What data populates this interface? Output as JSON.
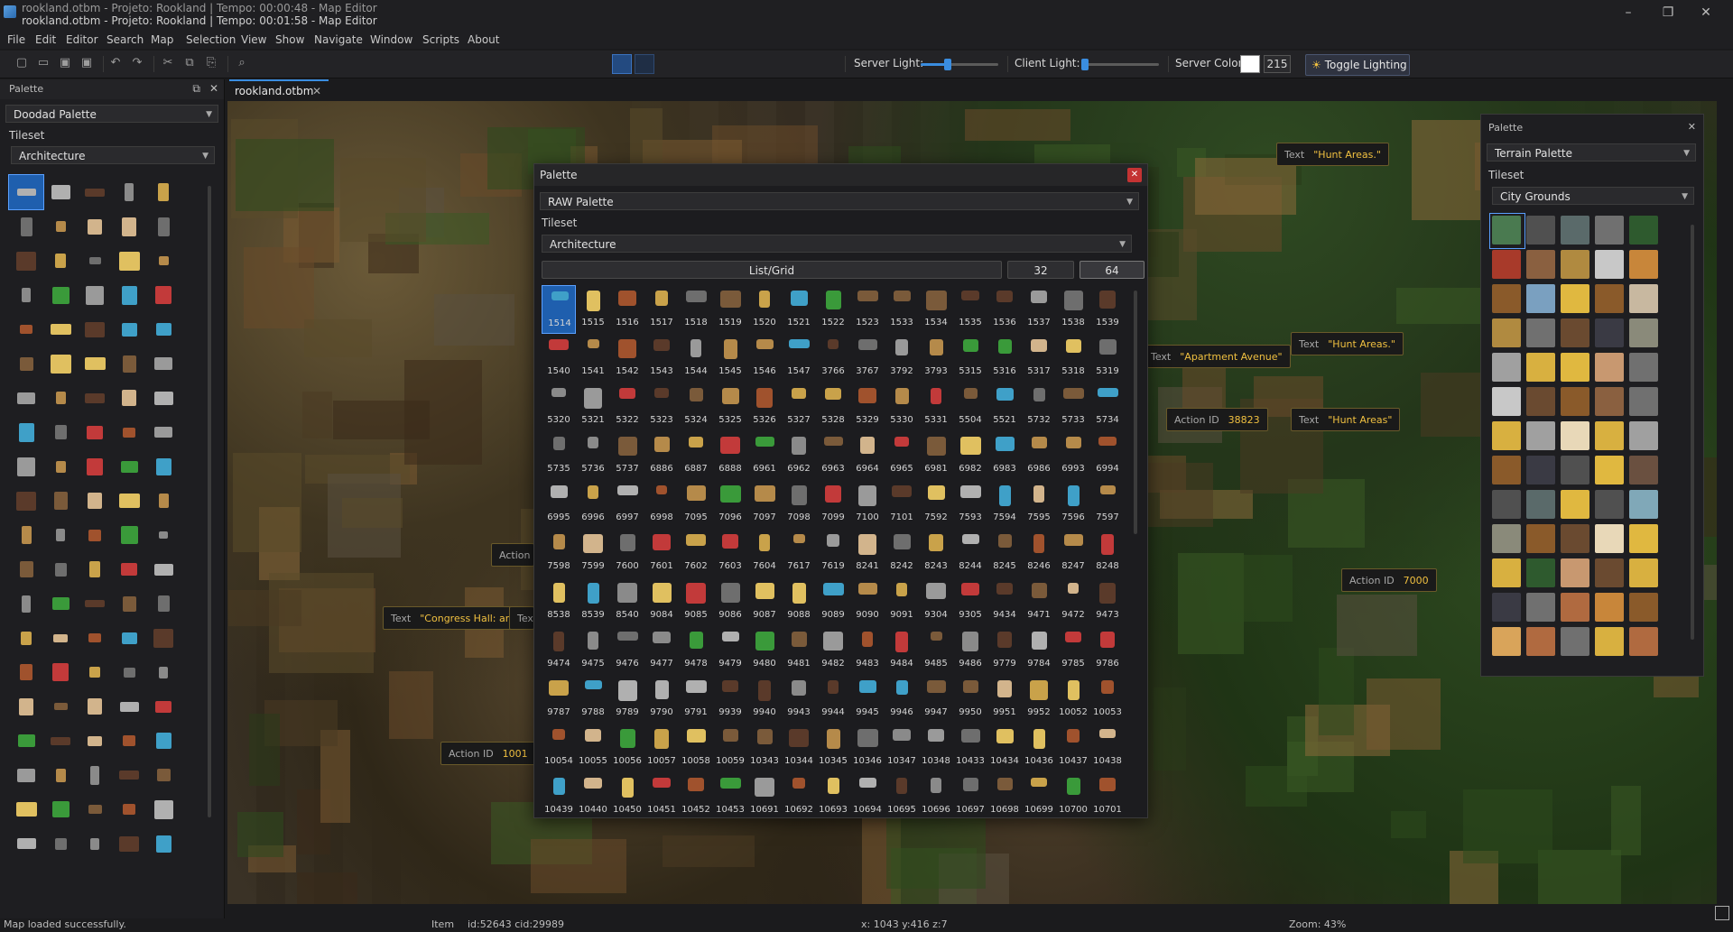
{
  "window": {
    "title_back": "rookland.otbm - Projeto: Rookland | Tempo: 00:00:48 - Map Editor",
    "title": "rookland.otbm - Projeto: Rookland | Tempo: 00:01:58 - Map Editor",
    "minimize": "–",
    "maximize": "❐",
    "close": "✕"
  },
  "menu": [
    "File",
    "Edit",
    "Editor",
    "Search",
    "Map",
    "Selection",
    "View",
    "Show",
    "Navigate",
    "Window",
    "Scripts",
    "About"
  ],
  "toolbar": {
    "server_light_label": "Server Light:",
    "server_light_level": 0.35,
    "client_light_label": "Client Light:",
    "client_light_level": 0.05,
    "server_color_label": "Server Color:",
    "server_color_value": "215",
    "toggle_lighting": "Toggle Lighting"
  },
  "left_palette": {
    "title": "Palette",
    "palette_select": "Doodad Palette",
    "tileset_label": "Tileset",
    "tileset_select": "Architecture"
  },
  "doc_tab": {
    "label": "rookland.otbm",
    "close": "✕"
  },
  "map_labels": [
    {
      "key": "Text",
      "value": "\"Hunt Areas.\""
    },
    {
      "key": "Text",
      "value": "\"Apartment Avenue\""
    },
    {
      "key": "Text",
      "value": "\"Hunt Areas.\""
    },
    {
      "key": "Action ID",
      "value": "38823"
    },
    {
      "key": "Text",
      "value": "\"Hunt Areas\""
    },
    {
      "key": "Action ID",
      "value": "7000"
    },
    {
      "key": "Text",
      "value": "\"Congress Hall: ar"
    },
    {
      "key": "Text",
      "value": ""
    },
    {
      "key": "Action",
      "value": ""
    },
    {
      "key": "Action ID",
      "value": "1001"
    }
  ],
  "raw_palette": {
    "title": "Palette",
    "close": "✕",
    "palette_select": "RAW Palette",
    "tileset_label": "Tileset",
    "tileset_select": "Architecture",
    "list_grid": "List/Grid",
    "size_small": "32",
    "size_large": "64",
    "item_ids": [
      "1514",
      "1515",
      "1516",
      "1517",
      "1518",
      "1519",
      "1520",
      "1521",
      "1522",
      "1523",
      "1533",
      "1534",
      "1535",
      "1536",
      "1537",
      "1538",
      "1539",
      "1540",
      "1541",
      "1542",
      "1543",
      "1544",
      "1545",
      "1546",
      "1547",
      "3766",
      "3767",
      "3792",
      "3793",
      "5315",
      "5316",
      "5317",
      "5318",
      "5319",
      "5320",
      "5321",
      "5322",
      "5323",
      "5324",
      "5325",
      "5326",
      "5327",
      "5328",
      "5329",
      "5330",
      "5331",
      "5504",
      "5521",
      "5732",
      "5733",
      "5734",
      "5735",
      "5736",
      "5737",
      "6886",
      "6887",
      "6888",
      "6961",
      "6962",
      "6963",
      "6964",
      "6965",
      "6981",
      "6982",
      "6983",
      "6986",
      "6993",
      "6994",
      "6995",
      "6996",
      "6997",
      "6998",
      "7095",
      "7096",
      "7097",
      "7098",
      "7099",
      "7100",
      "7101",
      "7592",
      "7593",
      "7594",
      "7595",
      "7596",
      "7597",
      "7598",
      "7599",
      "7600",
      "7601",
      "7602",
      "7603",
      "7604",
      "7617",
      "7619",
      "8241",
      "8242",
      "8243",
      "8244",
      "8245",
      "8246",
      "8247",
      "8248",
      "8538",
      "8539",
      "8540",
      "9084",
      "9085",
      "9086",
      "9087",
      "9088",
      "9089",
      "9090",
      "9091",
      "9304",
      "9305",
      "9434",
      "9471",
      "9472",
      "9473",
      "9474",
      "9475",
      "9476",
      "9477",
      "9478",
      "9479",
      "9480",
      "9481",
      "9482",
      "9483",
      "9484",
      "9485",
      "9486",
      "9779",
      "9784",
      "9785",
      "9786",
      "9787",
      "9788",
      "9789",
      "9790",
      "9791",
      "9939",
      "9940",
      "9943",
      "9944",
      "9945",
      "9946",
      "9947",
      "9950",
      "9951",
      "9952",
      "10052",
      "10053",
      "10054",
      "10055",
      "10056",
      "10057",
      "10058",
      "10059",
      "10343",
      "10344",
      "10345",
      "10346",
      "10347",
      "10348",
      "10433",
      "10434",
      "10436",
      "10437",
      "10438",
      "10439",
      "10440",
      "10450",
      "10451",
      "10452",
      "10453",
      "10691",
      "10692",
      "10693",
      "10694",
      "10695",
      "10696",
      "10697",
      "10698",
      "10699",
      "10700",
      "10701"
    ],
    "selected_id": "1514"
  },
  "right_palette": {
    "title": "Palette",
    "close": "✕",
    "palette_select": "Terrain Palette",
    "tileset_label": "Tileset",
    "tileset_select": "City Grounds"
  },
  "status": {
    "message": "Map loaded successfully.",
    "item": "Item",
    "item_ids": "id:52643 cid:29989",
    "coords": "x: 1043 y:416 z:7",
    "zoom": "Zoom: 43%"
  }
}
